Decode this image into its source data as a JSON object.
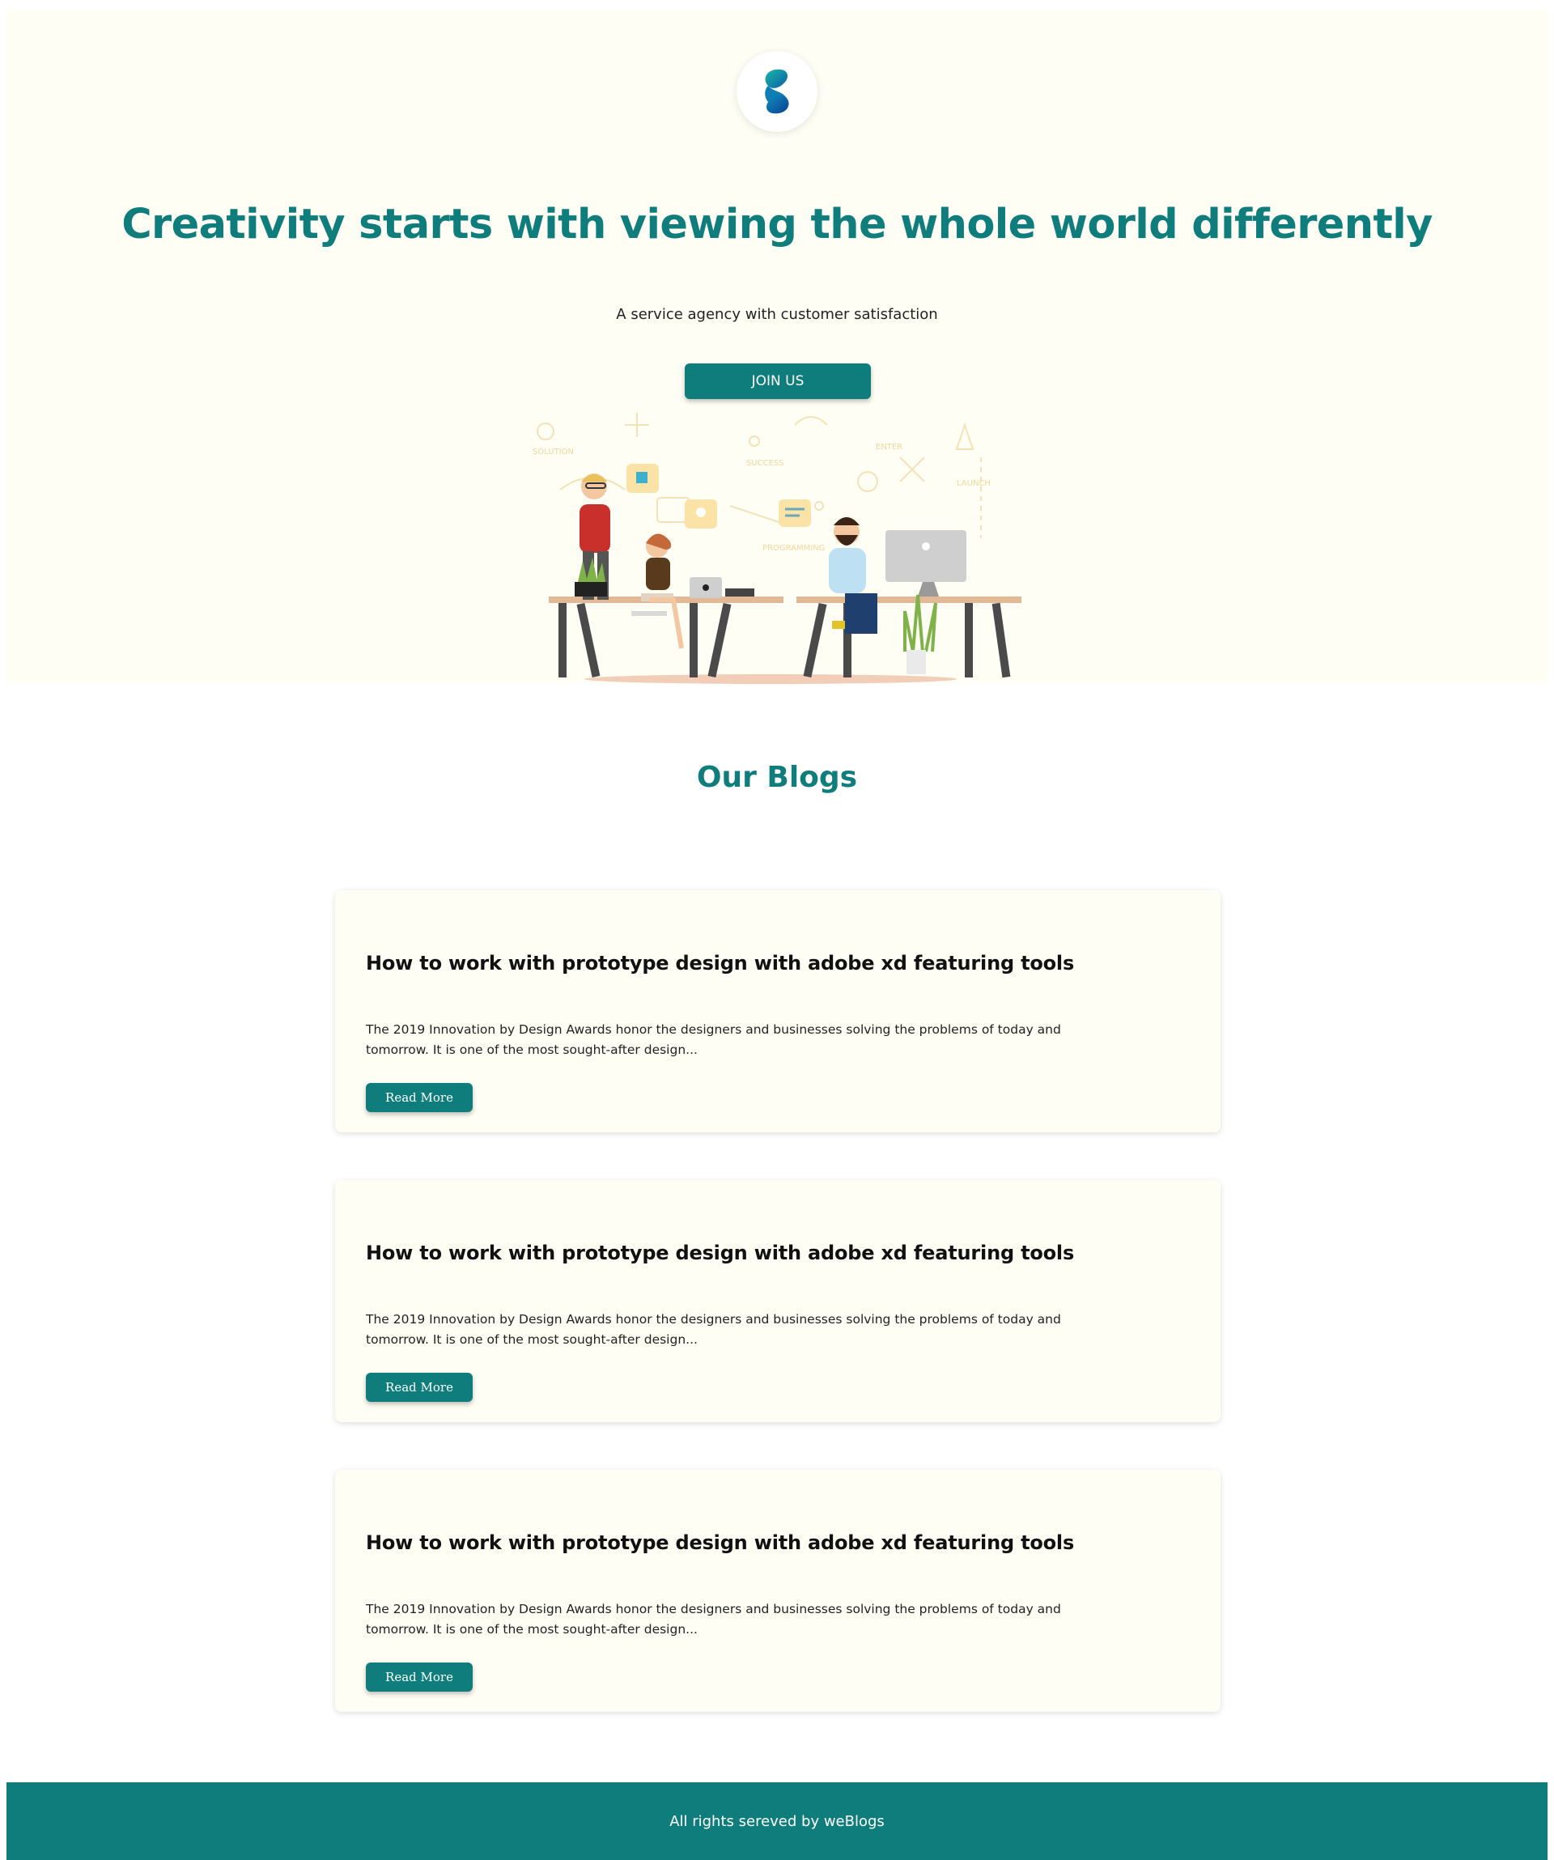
{
  "hero": {
    "logo_icon": "s-shape-logo-icon",
    "title": "Creativity starts with viewing the whole world differently",
    "subtitle": "A service agency with customer satisfaction",
    "join_label": "JOIN US",
    "illustration_words": [
      "SOLUTION",
      "SUCCESS",
      "ENTER",
      "PROGRAMMING",
      "LAUNCH"
    ]
  },
  "blogs": {
    "section_title": "Our Blogs",
    "posts": [
      {
        "title": "How to work with prototype design with adobe xd featuring tools",
        "excerpt": "The 2019 Innovation by Design Awards honor the designers and businesses solving the problems of today and tomorrow. It is one of the most sought-after design...",
        "button_label": "Read More"
      },
      {
        "title": "How to work with prototype design with adobe xd featuring tools",
        "excerpt": "The 2019 Innovation by Design Awards honor the designers and businesses solving the problems of today and tomorrow. It is one of the most sought-after design...",
        "button_label": "Read More"
      },
      {
        "title": "How to work with prototype design with adobe xd featuring tools",
        "excerpt": "The 2019 Innovation by Design Awards honor the designers and businesses solving the problems of today and tomorrow. It is one of the most sought-after design...",
        "button_label": "Read More"
      }
    ]
  },
  "footer": {
    "text": "All rights sereved by weBlogs"
  },
  "colors": {
    "accent": "#0e7d7b",
    "hero_bg": "#fefef5",
    "card_bg": "#fefef5"
  }
}
